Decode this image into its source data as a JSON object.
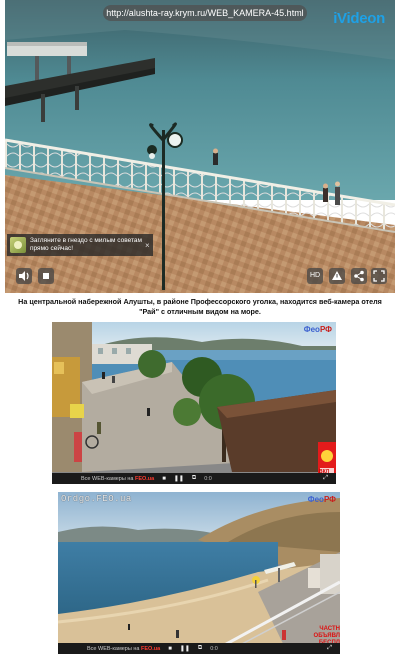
{
  "top_player": {
    "url": "http://alushta-ray.krym.ru/WEB_KAMERA-45.html",
    "brand": "iVideon",
    "notice_text": "Загляните в гнездо с милым советам прямо сейчас!",
    "notice_close": "×",
    "controls": {
      "volume_icon": "volume-icon",
      "stop_icon": "stop-icon",
      "quality_label": "HD",
      "alert_icon": "warning-icon",
      "share_icon": "share-icon",
      "fullscreen_icon": "fullscreen-icon"
    }
  },
  "caption": "На центральной набережной Алушты, в районе Профессорского уголка, находится веб-камера отеля \"Рай\" с отличным видом на море.",
  "cam2": {
    "logo_main": "Фео",
    "logo_suffix": "РФ",
    "promo_prefix": "Все WEB-камеры на ",
    "promo_site": "FEO.ua",
    "time": "0:0",
    "ad_text": "ВКЛ"
  },
  "cam3": {
    "overlay_label": "Ordgo.FEO.ua",
    "logo_main": "Фео",
    "logo_suffix": "РФ",
    "promo_prefix": "Все WEB-камеры на ",
    "promo_site": "FEO.ua",
    "time": "0:0",
    "ad_line1": "ЧАСТН",
    "ad_line2": "ОБЪЯВЛ",
    "ad_line3": "БЕСПЛ"
  },
  "colors": {
    "brand_blue": "#1ea1e6",
    "feo_blue": "#3a5fcf",
    "feo_red": "#c9201e",
    "promo_red": "#ff3b2f"
  }
}
